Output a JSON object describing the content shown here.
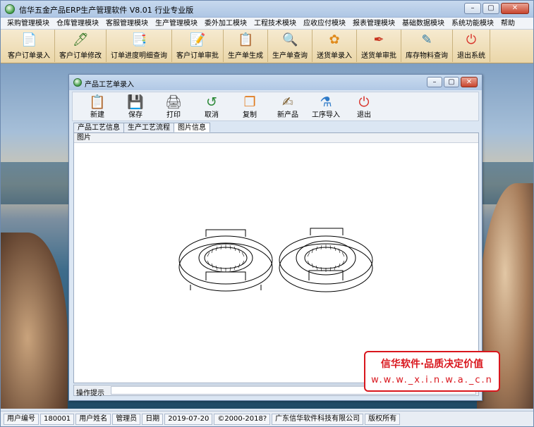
{
  "window": {
    "title": "信华五金产品ERP生产管理软件 V8.01 行业专业版",
    "min": "–",
    "max": "▢",
    "close": "✕"
  },
  "menu": [
    "采购管理模块",
    "仓库管理模块",
    "客服管理模块",
    "生产管理模块",
    "委外加工模块",
    "工程技术模块",
    "应收应付模块",
    "报表管理模块",
    "基础数据模块",
    "系统功能模块",
    "帮助"
  ],
  "toolbar": [
    {
      "label": "客户订单录入",
      "icon": "pdf-icon",
      "glyph": "📄",
      "color": "#c8321e"
    },
    {
      "label": "客户订单修改",
      "icon": "edit-doc-icon",
      "glyph": "🖊",
      "color": "#3a7a2a"
    },
    {
      "label": "订单进度明细查询",
      "icon": "search-doc-icon",
      "glyph": "📑",
      "color": "#6a52a8"
    },
    {
      "label": "客户订单审批",
      "icon": "approve-icon",
      "glyph": "📝",
      "color": "#2e61a8"
    },
    {
      "label": "生产单生成",
      "icon": "generate-icon",
      "glyph": "📋",
      "color": "#8a4aa8"
    },
    {
      "label": "生产单查询",
      "icon": "query-icon",
      "glyph": "🔍",
      "color": "#2e61a8"
    },
    {
      "label": "送货单录入",
      "icon": "flower-icon",
      "glyph": "✿",
      "color": "#e08a1c"
    },
    {
      "label": "送货单审批",
      "icon": "pen-icon",
      "glyph": "✒",
      "color": "#c8321e"
    },
    {
      "label": "库存物料查询",
      "icon": "quill-icon",
      "glyph": "✎",
      "color": "#2e7aa8"
    },
    {
      "label": "退出系统",
      "icon": "power-icon",
      "glyph": "⏻",
      "color": "#d8322a"
    }
  ],
  "child": {
    "title": "产品工艺单录入",
    "toolbar": [
      {
        "label": "新建",
        "icon": "clipboard-icon",
        "glyph": "📋",
        "color": "#b78b2a"
      },
      {
        "label": "保存",
        "icon": "save-icon",
        "glyph": "💾",
        "color": "#e0a21c"
      },
      {
        "label": "打印",
        "icon": "printer-icon",
        "glyph": "🖨",
        "color": "#555555"
      },
      {
        "label": "取消",
        "icon": "undo-icon",
        "glyph": "↺",
        "color": "#2e8a3a"
      },
      {
        "label": "复制",
        "icon": "copy-icon",
        "glyph": "❐",
        "color": "#e07a1c"
      },
      {
        "label": "新产品",
        "icon": "new-product-icon",
        "glyph": "✍",
        "color": "#7a5a2a"
      },
      {
        "label": "工序导入",
        "icon": "import-icon",
        "glyph": "⚗",
        "color": "#2e7ac8"
      },
      {
        "label": "退出",
        "icon": "exit-icon",
        "glyph": "⏻",
        "color": "#d8322a"
      }
    ],
    "tabs": [
      "产品工艺信息",
      "生产工艺流程",
      "图片信息"
    ],
    "active_tab": "图片信息",
    "panel_header": "图片",
    "op_label": "操作提示"
  },
  "watermark": {
    "line1": "信华软件·品质决定价值",
    "line2": "w.w.w._x.i.n.w.a._c.n"
  },
  "status": [
    "用户编号",
    "180001",
    "用户姓名",
    "管理员",
    "日期",
    "2019-07-20",
    "©2000-2018?",
    "广东信华软件科技有限公司",
    "版权所有"
  ]
}
